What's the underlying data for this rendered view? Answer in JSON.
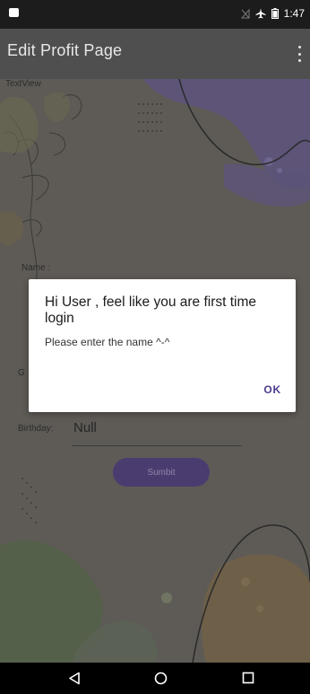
{
  "status_bar": {
    "time": "1:47",
    "icons": [
      "sim-card-icon",
      "no-signal-icon",
      "airplane-mode-icon",
      "battery-icon"
    ]
  },
  "app_bar": {
    "title": "Edit Profit Page",
    "menu_icon": "overflow-menu-icon"
  },
  "form": {
    "textview_label": "TextView",
    "name_label": "Name :",
    "gender_label_partial": "G",
    "birthday_label": "Birthday:",
    "birthday_value": "Null",
    "submit_label": "Sumbit"
  },
  "dialog": {
    "title": "Hi User , feel like you are first time login",
    "message": "Please enter the name ^-^",
    "ok_label": "OK"
  },
  "nav_bar": {
    "icons": [
      "back-icon",
      "home-icon",
      "recents-icon"
    ]
  },
  "colors": {
    "accent": "#4e3c8d",
    "button": "#4b3c70",
    "scrim_app_bar": "#4f4f4f"
  }
}
